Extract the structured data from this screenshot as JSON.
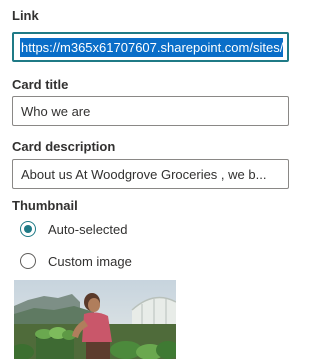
{
  "link": {
    "label": "Link",
    "value": "https://m365x61707607.sharepoint.com/sites/"
  },
  "card_title": {
    "label": "Card title",
    "value": "Who we are"
  },
  "card_description": {
    "label": "Card description",
    "value": "About us At Woodgrove Groceries , we b..."
  },
  "thumbnail": {
    "label": "Thumbnail",
    "options": [
      {
        "label": "Auto-selected",
        "checked": true
      },
      {
        "label": "Custom image",
        "checked": false
      }
    ],
    "image_icon": "greenhouse-photo"
  },
  "colors": {
    "accent": "#1f7a86",
    "selection": "#0a6ec8",
    "border": "#8a8886"
  }
}
